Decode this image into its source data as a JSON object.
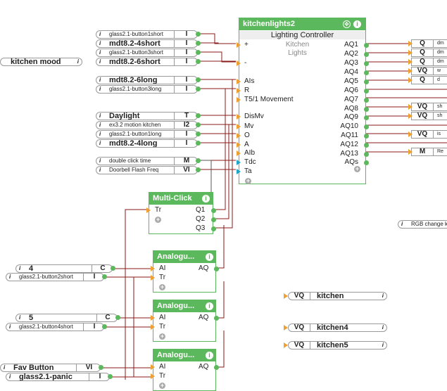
{
  "main_block": {
    "title": "kitchenlights2",
    "subtitle": "Lighting Controller",
    "room_line1": "Kitchen",
    "room_line2": "Lights",
    "inputs": [
      "+",
      "-",
      "AIs",
      "R",
      "T5/1 Movement",
      "DisMv",
      "Mv",
      "O",
      "A",
      "AIb",
      "Tdc",
      "Ta"
    ],
    "outputs": [
      "AQ1",
      "AQ2",
      "AQ3",
      "AQ4",
      "AQ5",
      "AQ6",
      "AQ7",
      "AQ8",
      "AQ9",
      "AQ10",
      "AQ11",
      "AQ12",
      "AQ13",
      "AQs"
    ]
  },
  "multiclick": {
    "title": "Multi-Click",
    "input": "Tr",
    "outputs": [
      "Q1",
      "Q2",
      "Q3"
    ]
  },
  "analog_blocks": [
    {
      "title": "Analogu...",
      "in1": "AI",
      "in2": "Tr",
      "out": "AQ"
    },
    {
      "title": "Analogu...",
      "in1": "AI",
      "in2": "Tr",
      "out": "AQ"
    },
    {
      "title": "Analogu...",
      "in1": "AI",
      "in2": "Tr",
      "out": "AQ"
    }
  ],
  "left_memory": {
    "name": "kitchen mood"
  },
  "inputs": [
    {
      "name": "glass2.1-button1short",
      "type": "I"
    },
    {
      "name": "mdt8.2-4short",
      "type": "I"
    },
    {
      "name": "glass2.1-button3short",
      "type": "I"
    },
    {
      "name": "mdt8.2-6short",
      "type": "I"
    },
    {
      "name": "mdt8.2-6long",
      "type": "I"
    },
    {
      "name": "glass2.1-button3long",
      "type": "I"
    },
    {
      "name": "Daylight",
      "type": "T"
    },
    {
      "name": "ex3.2 motion kitchen",
      "type": "I2"
    },
    {
      "name": "glass2.1-button1long",
      "type": "I"
    },
    {
      "name": "mdt8.2-4long",
      "type": "I"
    },
    {
      "name": "double click time",
      "type": "M"
    },
    {
      "name": "Doorbell Flash Freq",
      "type": "VI"
    }
  ],
  "outputs": [
    {
      "type": "Q",
      "name": "dm"
    },
    {
      "type": "Q",
      "name": "dm"
    },
    {
      "type": "Q",
      "name": "dm"
    },
    {
      "type": "VQ",
      "name": "w"
    },
    {
      "type": "Q",
      "name": "d"
    },
    {
      "type": "VQ",
      "name": "sh"
    },
    {
      "type": "VQ",
      "name": "sh"
    },
    {
      "type": "VQ",
      "name": "is"
    },
    {
      "type": "M",
      "name": "Re"
    }
  ],
  "rgb_note": "RGB change ki",
  "memory_inputs": [
    {
      "name": "4",
      "type": "C"
    },
    {
      "name": "glass2.1-button2short",
      "type": "I"
    },
    {
      "name": "5",
      "type": "C"
    },
    {
      "name": "glass2.1-button4short",
      "type": "I"
    },
    {
      "name": "Fav Button",
      "type": "VI"
    },
    {
      "name": "glass2.1-panic",
      "type": "I"
    }
  ],
  "vq_outputs": [
    {
      "type": "VQ",
      "name": "kitchen"
    },
    {
      "type": "VQ",
      "name": "kitchen4"
    },
    {
      "type": "VQ",
      "name": "kitchen5"
    }
  ],
  "icons": {
    "info": "i",
    "plus": "+",
    "gear": "✥"
  },
  "colors": {
    "block": "#5cb85c",
    "wire": "#8b1a1a",
    "input_arrow": "#f0a030",
    "param_arrow": "#1fa6c9"
  }
}
